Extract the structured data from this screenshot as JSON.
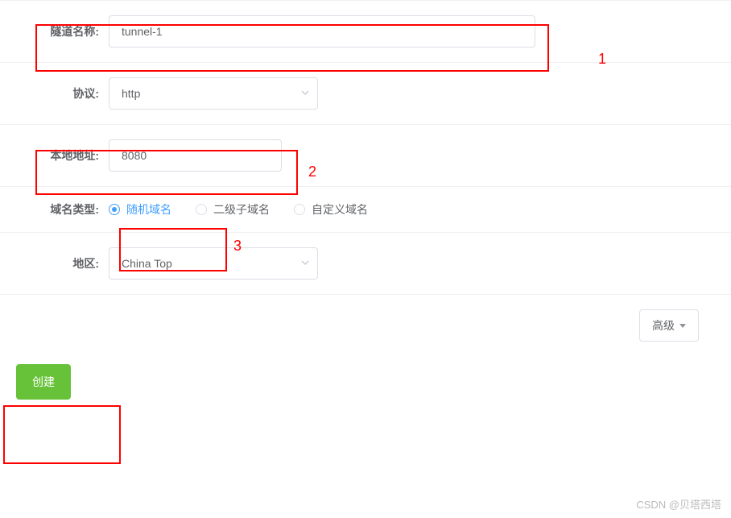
{
  "form": {
    "tunnel_name": {
      "label": "隧道名称:",
      "value": "tunnel-1"
    },
    "protocol": {
      "label": "协议:",
      "value": "http"
    },
    "local_addr": {
      "label": "本地地址:",
      "value": "8080"
    },
    "domain_type": {
      "label": "域名类型:",
      "options": [
        {
          "label": "随机域名",
          "checked": true
        },
        {
          "label": "二级子域名",
          "checked": false
        },
        {
          "label": "自定义域名",
          "checked": false
        }
      ]
    },
    "region": {
      "label": "地区:",
      "value": "China Top"
    }
  },
  "buttons": {
    "advanced": "高级",
    "create": "创建"
  },
  "annotations": {
    "n1": "1",
    "n2": "2",
    "n3": "3"
  },
  "watermark": "CSDN @贝塔西塔"
}
